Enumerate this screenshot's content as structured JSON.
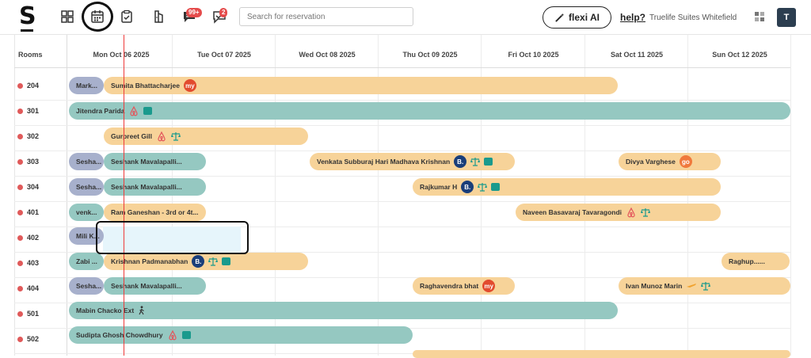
{
  "brand": {
    "logo": "S"
  },
  "toolbar": {
    "chat_badge": "99+",
    "tasks_badge": "2",
    "search_placeholder": "Search for reservation",
    "flexi_label": "flexi AI",
    "help_label": "help?",
    "property_name": "Truelife Suites Whitefield",
    "avatar_initial": "T"
  },
  "calendar": {
    "rooms_label": "Rooms",
    "days": [
      "Mon Oct 06 2025",
      "Tue Oct 07 2025",
      "Wed Oct 08 2025",
      "Thu Oct 09 2025",
      "Fri Oct 10 2025",
      "Sat Oct 11 2025",
      "Sun Oct 12 2025"
    ],
    "rooms": [
      "204",
      "301",
      "302",
      "303",
      "304",
      "401",
      "402",
      "403",
      "404",
      "501",
      "502"
    ],
    "bookings": {
      "r204_a": "Mark...",
      "r204_b": "Sumita Bhattacharjee",
      "r301_a": "Jitendra Parida",
      "r302_a": "Gurpreet Gill",
      "r303_a": "Sesha...",
      "r303_b": "Seshank Mavalapalli...",
      "r303_c": "Venkata Subburaj Hari Madhava Krishnan",
      "r303_d": "Divya Varghese",
      "r304_a": "Sesha...",
      "r304_b": "Seshank Mavalapalli...",
      "r304_c": "Rajkumar H",
      "r401_a": "venk...",
      "r401_b": "Ram Ganeshan - 3rd or 4t...",
      "r401_c": "Naveen Basavaraj Tavaragondi",
      "r402_a": "Mili K...",
      "r403_a": "Zabi ...",
      "r403_b": "Krishnan Padmanabhan",
      "r403_c": "Raghup......",
      "r404_a": "Sesha...",
      "r404_b": "Seshank Mavalapalli...",
      "r404_c": "Raghavendra bhat",
      "r404_d": "Ivan Munoz Marin",
      "r501_a": "Mabin Chacko Ext",
      "r502_a": "Sudipta Ghosh Chowdhury"
    },
    "badges": {
      "booking": "B.",
      "goibibo": "go",
      "mmt": "my"
    }
  },
  "colors": {
    "teal": "#95c8c1",
    "orange": "#f7d399",
    "grey": "#a7b0cc",
    "now_line": "#ee3b3b"
  }
}
